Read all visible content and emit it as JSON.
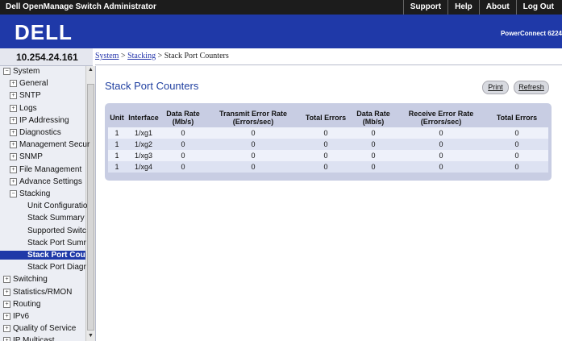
{
  "app_title": "Dell OpenManage Switch Administrator",
  "top_links": [
    "Support",
    "Help",
    "About",
    "Log Out"
  ],
  "brand": {
    "logo": "DELL",
    "product": "PowerConnect 6224"
  },
  "ip_address": "10.254.24.161",
  "breadcrumb": {
    "system": "System",
    "sep1": " > ",
    "stacking": "Stacking",
    "sep2": " > ",
    "current": "Stack Port Counters"
  },
  "sidebar": {
    "items": [
      {
        "label": "System",
        "level": 0,
        "exp": "⊟"
      },
      {
        "label": "General",
        "level": 1,
        "exp": "⊞"
      },
      {
        "label": "SNTP",
        "level": 1,
        "exp": "⊞"
      },
      {
        "label": "Logs",
        "level": 1,
        "exp": "⊞"
      },
      {
        "label": "IP Addressing",
        "level": 1,
        "exp": "⊞"
      },
      {
        "label": "Diagnostics",
        "level": 1,
        "exp": "⊞"
      },
      {
        "label": "Management Secur",
        "level": 1,
        "exp": "⊞"
      },
      {
        "label": "SNMP",
        "level": 1,
        "exp": "⊞"
      },
      {
        "label": "File Management",
        "level": 1,
        "exp": "⊞"
      },
      {
        "label": "Advance Settings",
        "level": 1,
        "exp": "⊞"
      },
      {
        "label": "Stacking",
        "level": 1,
        "exp": "⊟"
      },
      {
        "label": "Unit Configuratio",
        "level": 2,
        "exp": ""
      },
      {
        "label": "Stack Summary",
        "level": 2,
        "exp": ""
      },
      {
        "label": "Supported Switc",
        "level": 2,
        "exp": ""
      },
      {
        "label": "Stack Port Sumr",
        "level": 2,
        "exp": ""
      },
      {
        "label": "Stack Port Cou",
        "level": 2,
        "exp": "",
        "selected": true
      },
      {
        "label": "Stack Port Diagr",
        "level": 2,
        "exp": ""
      },
      {
        "label": "Switching",
        "level": 0,
        "exp": "⊞"
      },
      {
        "label": "Statistics/RMON",
        "level": 0,
        "exp": "⊞"
      },
      {
        "label": "Routing",
        "level": 0,
        "exp": "⊞"
      },
      {
        "label": "IPv6",
        "level": 0,
        "exp": "⊞"
      },
      {
        "label": "Quality of Service",
        "level": 0,
        "exp": "⊞"
      },
      {
        "label": "IP Multicast",
        "level": 0,
        "exp": "⊞"
      }
    ]
  },
  "page_title": "Stack Port Counters",
  "buttons": {
    "print": "Print",
    "refresh": "Refresh"
  },
  "table": {
    "headers": [
      [
        "Unit"
      ],
      [
        "Interface"
      ],
      [
        "Data Rate",
        "(Mb/s)"
      ],
      [
        "Transmit Error Rate",
        "(Errors/sec)"
      ],
      [
        "Total Errors"
      ],
      [
        "Data Rate",
        "(Mb/s)"
      ],
      [
        "Receive Error Rate",
        "(Errors/sec)"
      ],
      [
        "Total Errors"
      ]
    ],
    "rows": [
      [
        "1",
        "1/xg1",
        "0",
        "0",
        "0",
        "0",
        "0",
        "0"
      ],
      [
        "1",
        "1/xg2",
        "0",
        "0",
        "0",
        "0",
        "0",
        "0"
      ],
      [
        "1",
        "1/xg3",
        "0",
        "0",
        "0",
        "0",
        "0",
        "0"
      ],
      [
        "1",
        "1/xg4",
        "0",
        "0",
        "0",
        "0",
        "0",
        "0"
      ]
    ]
  }
}
